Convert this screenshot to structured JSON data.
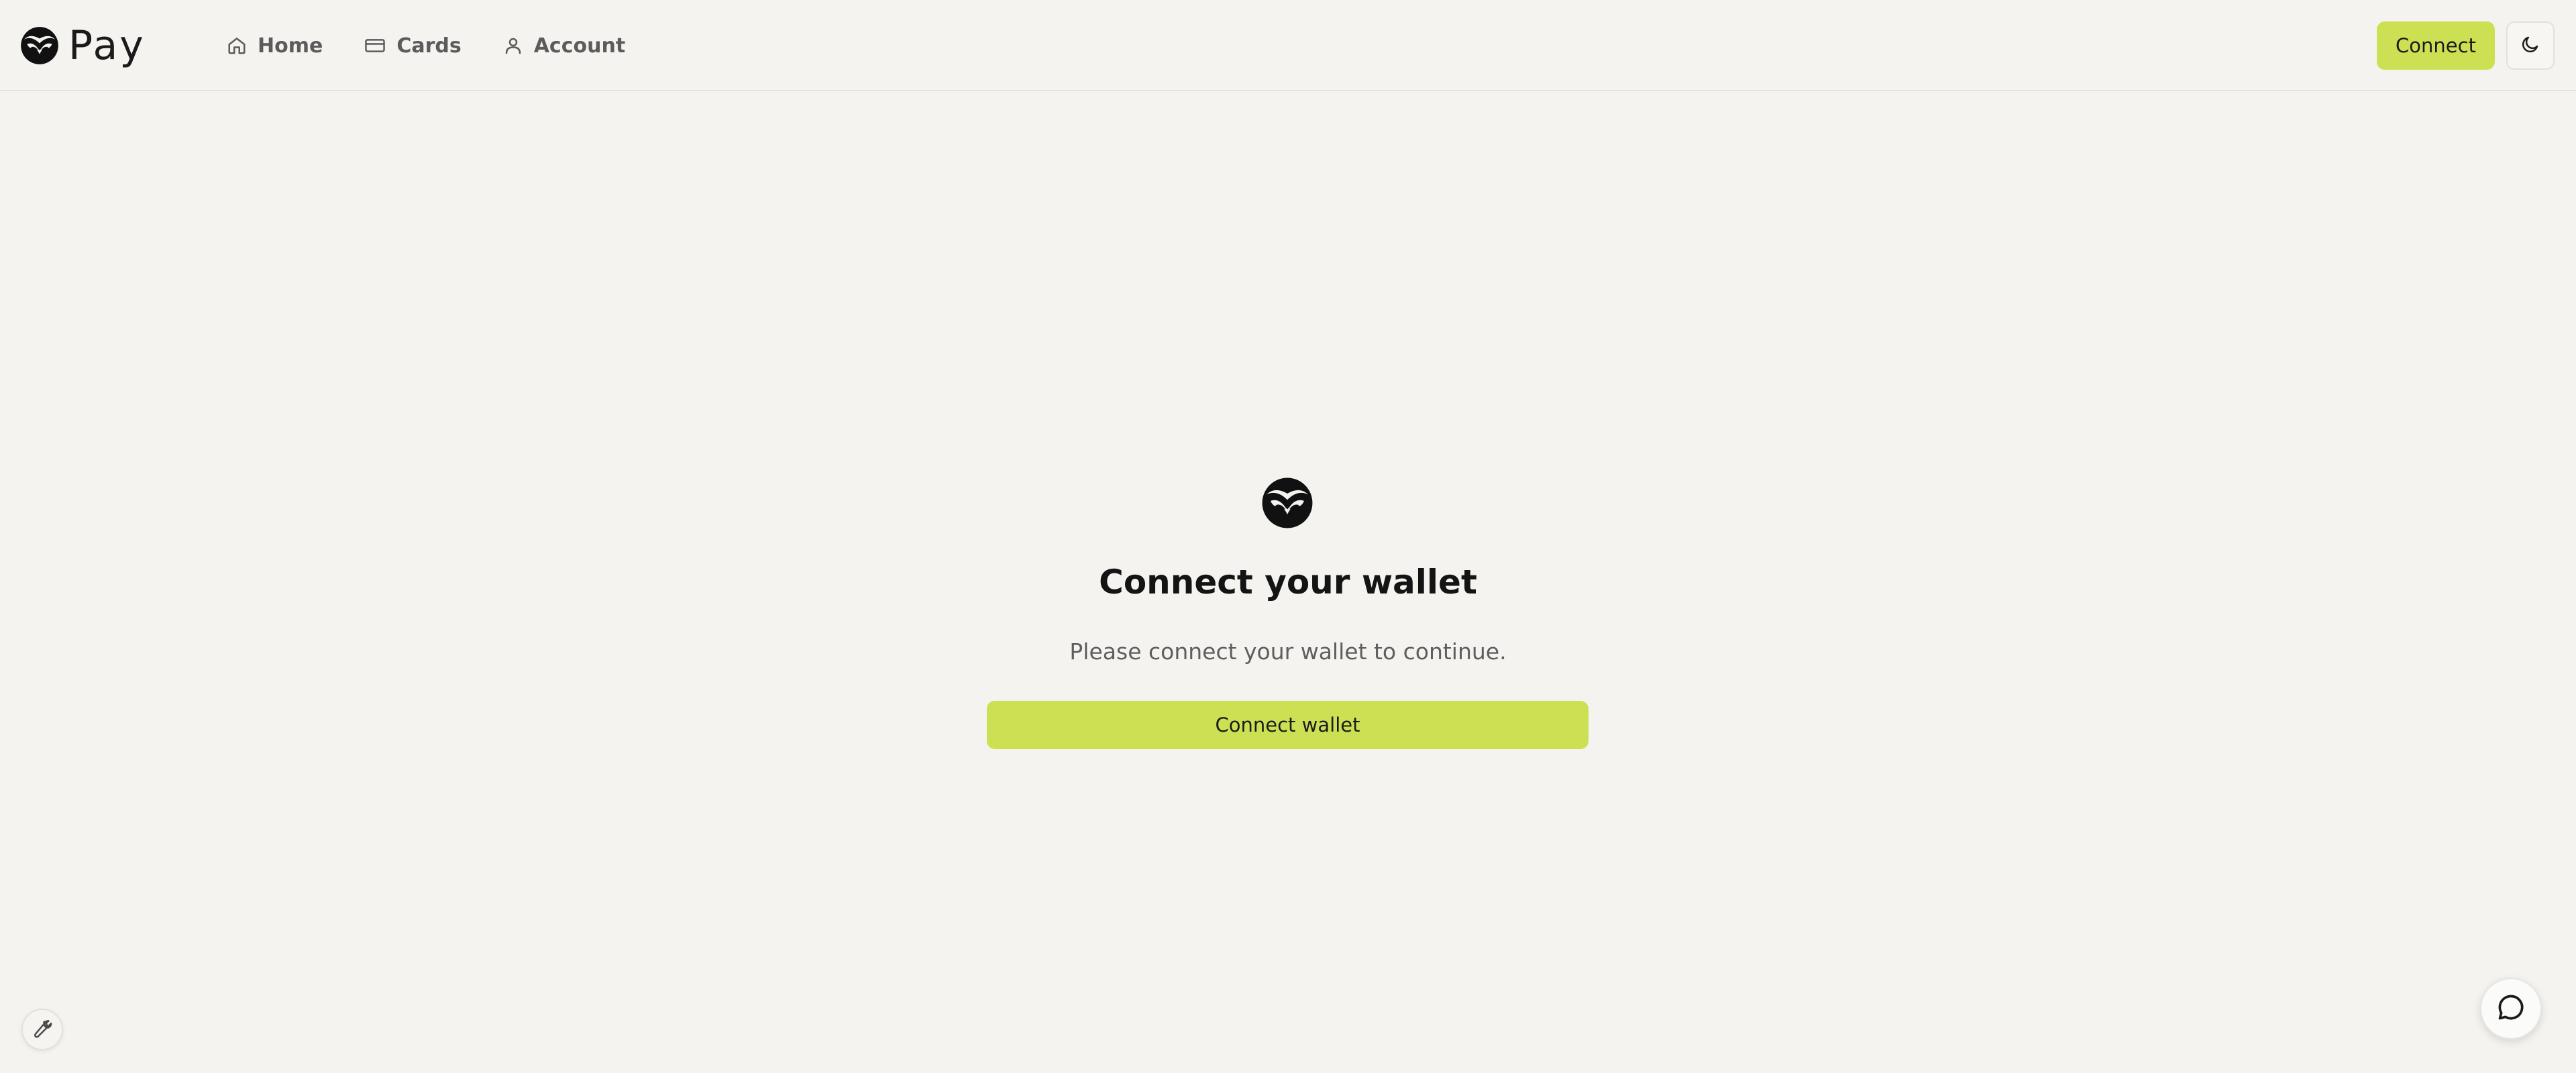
{
  "brand": {
    "name": "Pay",
    "accent_color": "#cde053"
  },
  "nav": {
    "items": [
      {
        "label": "Home",
        "icon": "home-icon"
      },
      {
        "label": "Cards",
        "icon": "card-icon"
      },
      {
        "label": "Account",
        "icon": "user-icon"
      }
    ]
  },
  "header": {
    "connect_label": "Connect",
    "theme_toggle_icon": "moon-icon"
  },
  "main": {
    "title": "Connect your wallet",
    "subtitle": "Please connect your wallet to continue.",
    "button_label": "Connect wallet",
    "icon": "owl-logo-icon"
  },
  "floating": {
    "dev_tools_icon": "wrench-icon",
    "chat_icon": "chat-bubble-icon"
  }
}
